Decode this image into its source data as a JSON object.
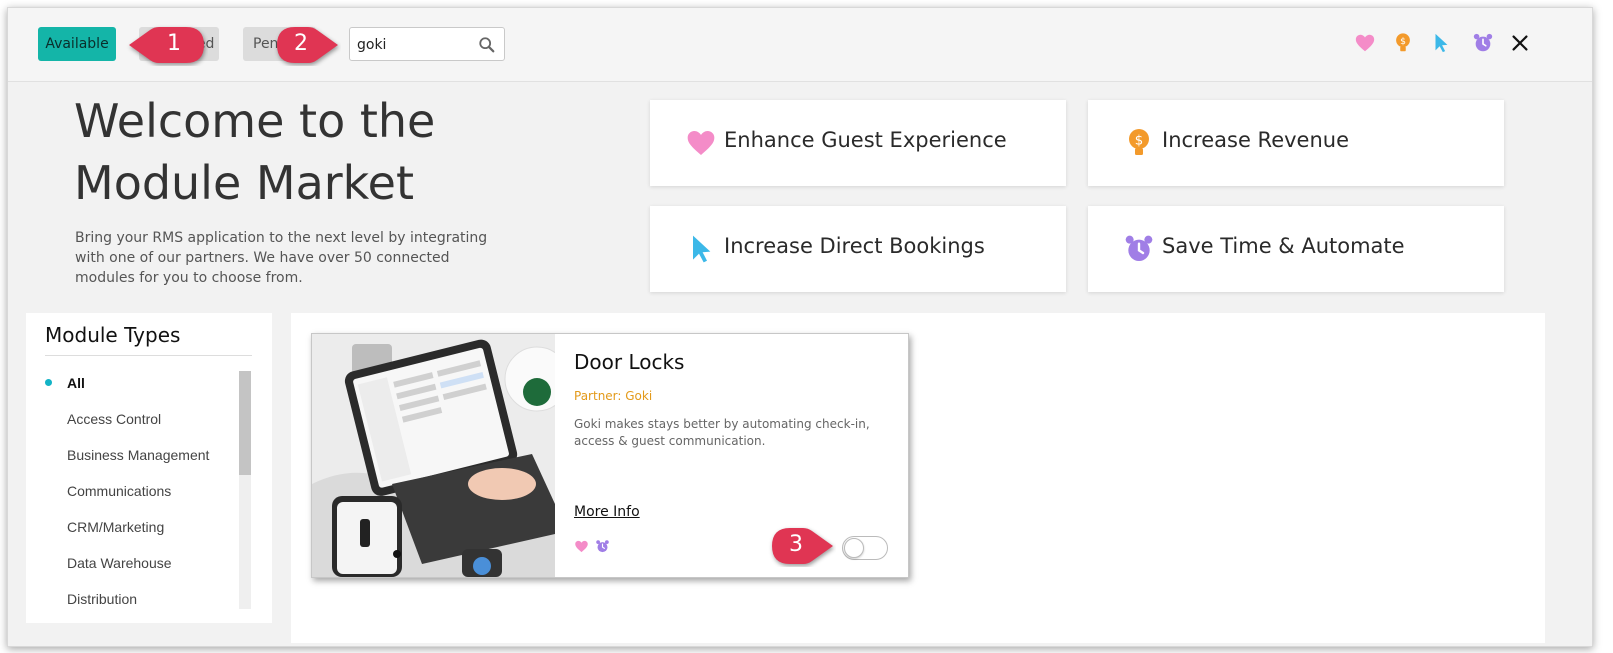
{
  "filters": {
    "available_label": "Available",
    "connected_label": "Connected",
    "pending_label": "Pending"
  },
  "search": {
    "value": "goki",
    "placeholder": ""
  },
  "callouts": [
    "1",
    "2",
    "3"
  ],
  "top_icons": [
    "heart-icon",
    "money-bulb-icon",
    "cursor-icon",
    "alarm-clock-icon",
    "close-icon"
  ],
  "welcome": {
    "title_line1": "Welcome to the",
    "title_line2": "Module Market",
    "description": "Bring your RMS application to the next level by integrating with one of our partners. We have over 50 connected modules for you to choose from."
  },
  "goals": [
    {
      "label": "Enhance Guest Experience",
      "icon": "heart-icon",
      "color": "#f48cc8"
    },
    {
      "label": "Increase Revenue",
      "icon": "money-bulb-icon",
      "color": "#f39a2b"
    },
    {
      "label": "Increase Direct Bookings",
      "icon": "cursor-icon",
      "color": "#3cb8e8"
    },
    {
      "label": "Save Time & Automate",
      "icon": "alarm-clock-icon",
      "color": "#a07ee6"
    }
  ],
  "module_types": {
    "title": "Module Types",
    "items": [
      "All",
      "Access Control",
      "Business Management",
      "Communications",
      "CRM/Marketing",
      "Data Warehouse",
      "Distribution"
    ],
    "active": "All"
  },
  "module": {
    "title": "Door Locks",
    "partner": "Partner: Goki",
    "description": "Goki makes stays better by automating check-in, access & guest communication.",
    "more_info": "More Info",
    "tags": [
      "heart-icon",
      "alarm-clock-icon"
    ],
    "enabled": false
  },
  "colors": {
    "accent": "#14b5a8",
    "callout": "#e03553",
    "partner": "#e39a1a"
  }
}
